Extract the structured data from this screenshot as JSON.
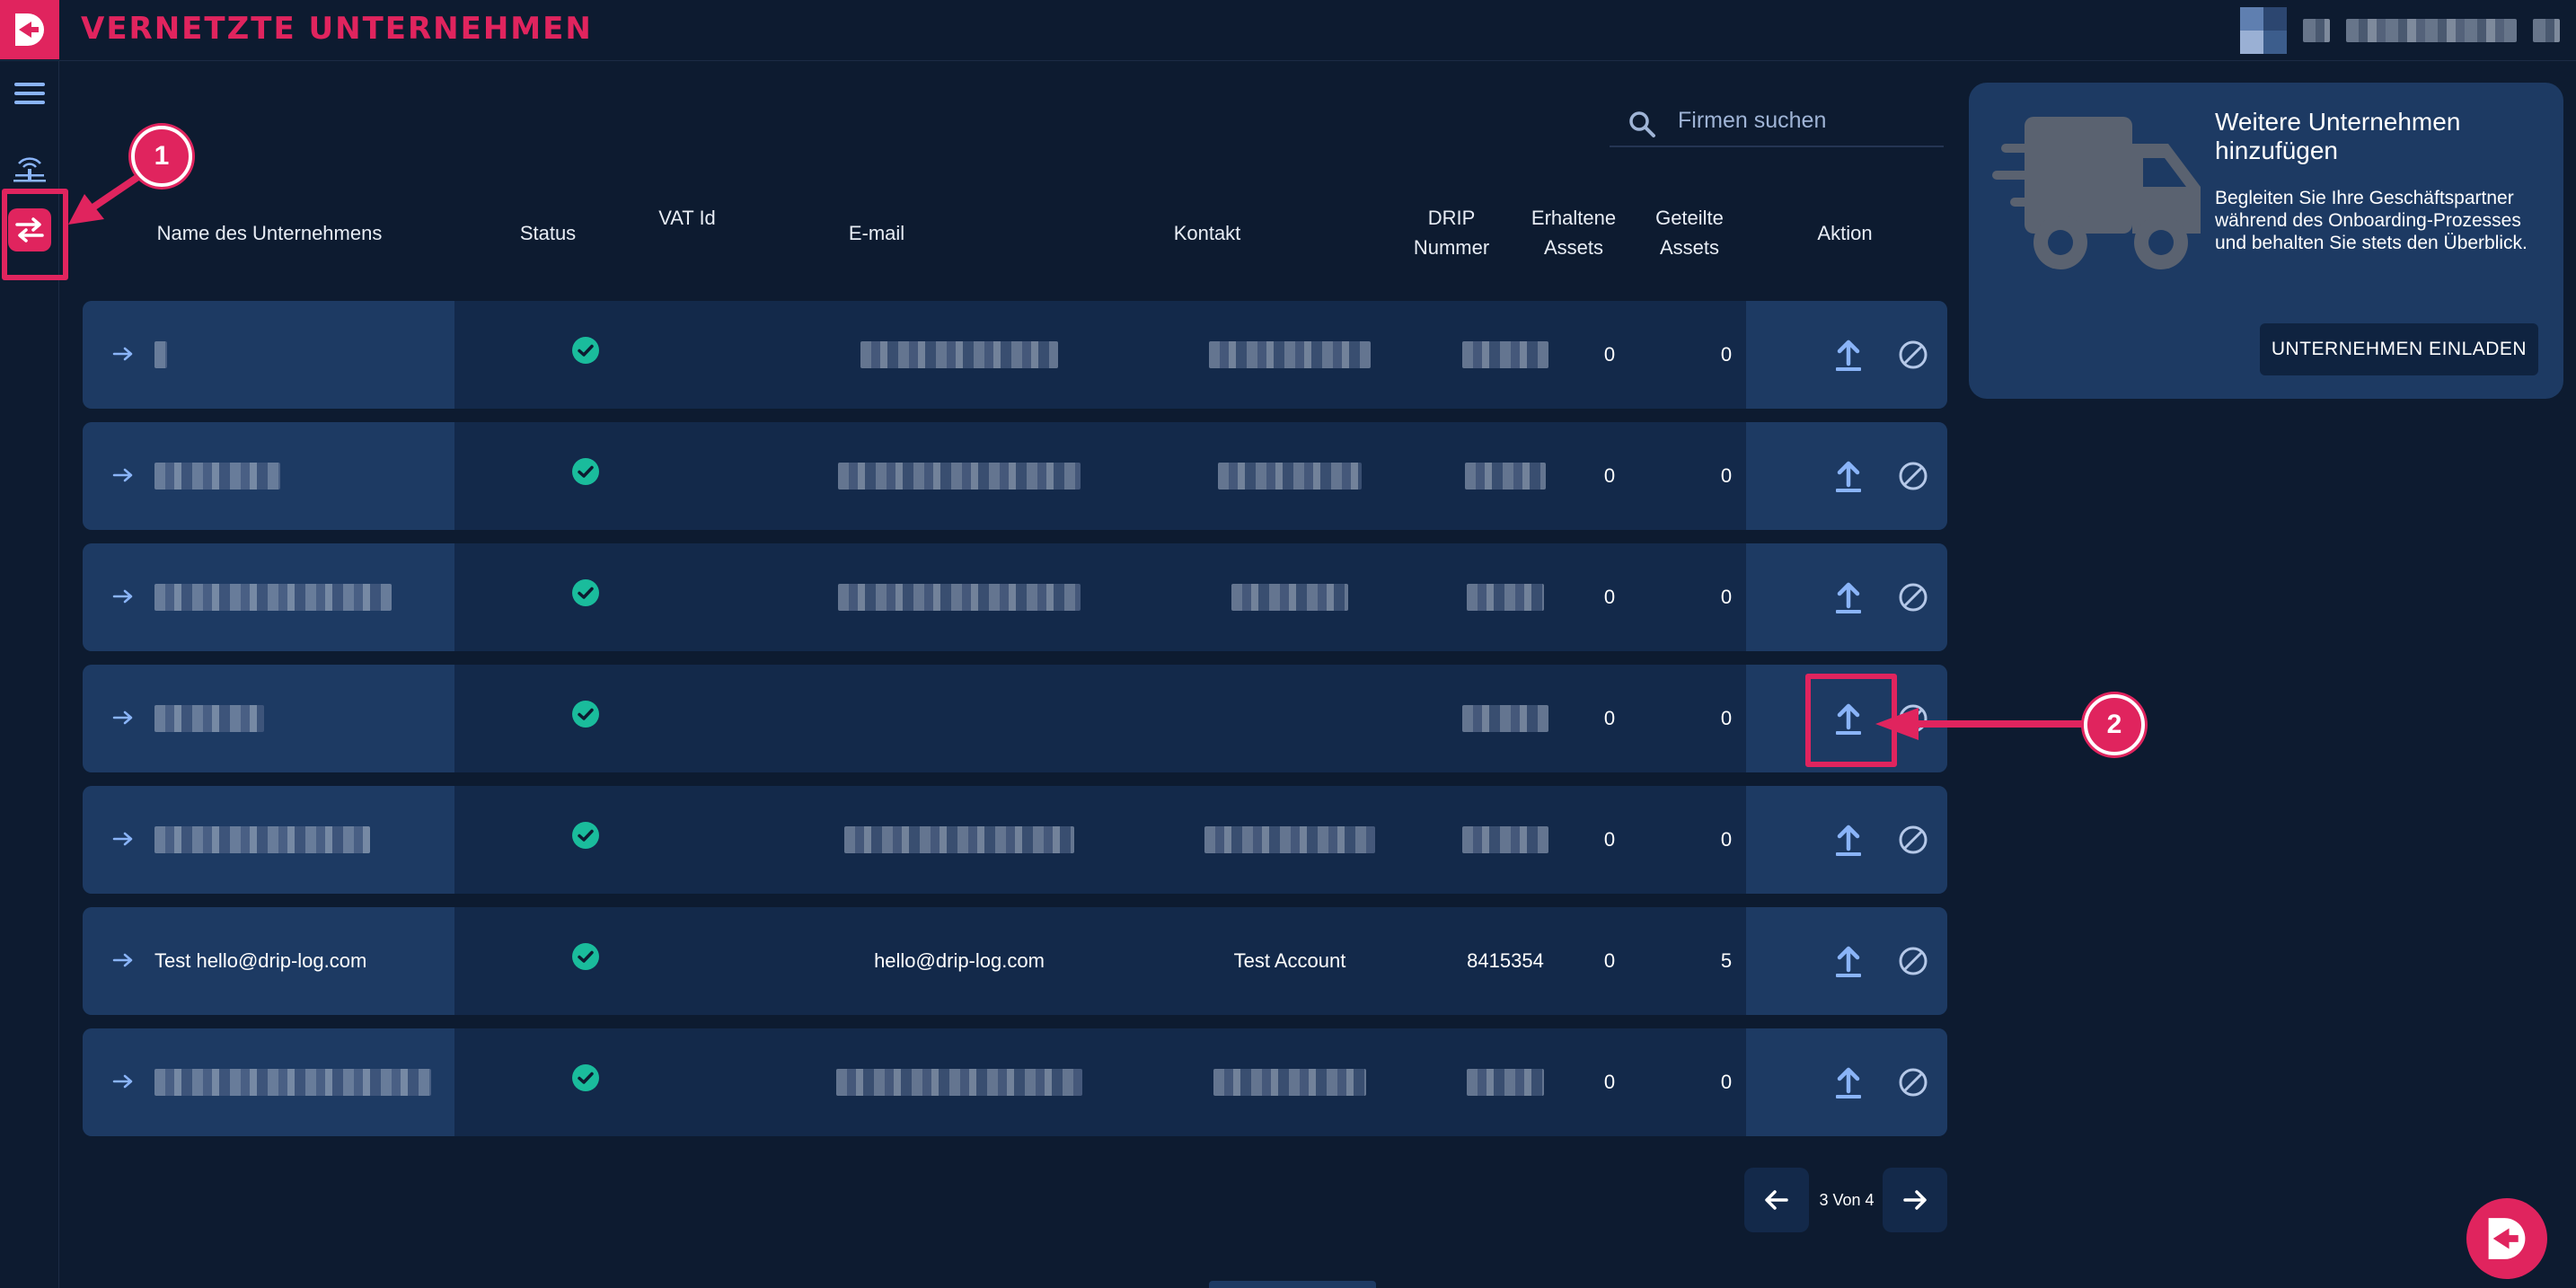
{
  "app": {
    "page_title": "VERNETZTE UNTERNEHMEN",
    "accent": "#e0245e",
    "logo_icon": "drip-logo"
  },
  "rail": {
    "items": [
      {
        "name": "menu-icon"
      },
      {
        "name": "network-icon"
      },
      {
        "name": "exchange-icon",
        "active": true
      }
    ]
  },
  "search": {
    "placeholder": "Firmen suchen",
    "icon": "search-icon"
  },
  "table": {
    "headers": {
      "name": "Name des Unternehmens",
      "status": "Status",
      "vat": "VAT Id",
      "email": "E-mail",
      "kontakt": "Kontakt",
      "drip": "DRIP Nummer",
      "erhaltene": "Erhaltene Assets",
      "geteilte": "Geteilte Assets",
      "aktion": "Aktion"
    },
    "rows": [
      {
        "name": "",
        "status": "check-circle-icon",
        "vat": "",
        "email": "",
        "kontakt": "",
        "drip": "",
        "erhaltene": "0",
        "geteilte": "0"
      },
      {
        "name": "",
        "status": "check-circle-icon",
        "vat": "",
        "email": "",
        "kontakt": "",
        "drip": "",
        "erhaltene": "0",
        "geteilte": "0"
      },
      {
        "name": "",
        "status": "check-circle-icon",
        "vat": "",
        "email": "",
        "kontakt": "",
        "drip": "",
        "erhaltene": "0",
        "geteilte": "0"
      },
      {
        "name": "",
        "status": "check-circle-icon",
        "vat": "",
        "email": "",
        "kontakt": "",
        "drip": "",
        "erhaltene": "0",
        "geteilte": "0"
      },
      {
        "name": "",
        "status": "check-circle-icon",
        "vat": "",
        "email": "",
        "kontakt": "",
        "drip": "",
        "erhaltene": "0",
        "geteilte": "0"
      },
      {
        "name": "Test hello@drip-log.com",
        "status": "check-circle-icon",
        "vat": "",
        "email": "hello@drip-log.com",
        "kontakt": "Test Account",
        "drip": "8415354",
        "erhaltene": "0",
        "geteilte": "5"
      },
      {
        "name": "",
        "status": "check-circle-icon",
        "vat": "",
        "email": "",
        "kontakt": "",
        "drip": "",
        "erhaltene": "0",
        "geteilte": "0"
      }
    ]
  },
  "card": {
    "title": "Weitere Unternehmen hinzufügen",
    "text": "Begleiten Sie Ihre Geschäftspartner während des Onboarding-Prozesses und behalten Sie stets den Überblick.",
    "button": "UNTERNEHMEN EINLADEN",
    "icon": "truck-icon"
  },
  "pagination": {
    "label": "3 Von 4"
  },
  "annotations": {
    "badge1": "1",
    "badge2": "2"
  },
  "colors": {
    "background": "#0d1b30",
    "row": "#13294a",
    "row_accent": "#1d3a63",
    "status_ok": "#1abc9c",
    "action_icon": "#8ab4f8"
  }
}
